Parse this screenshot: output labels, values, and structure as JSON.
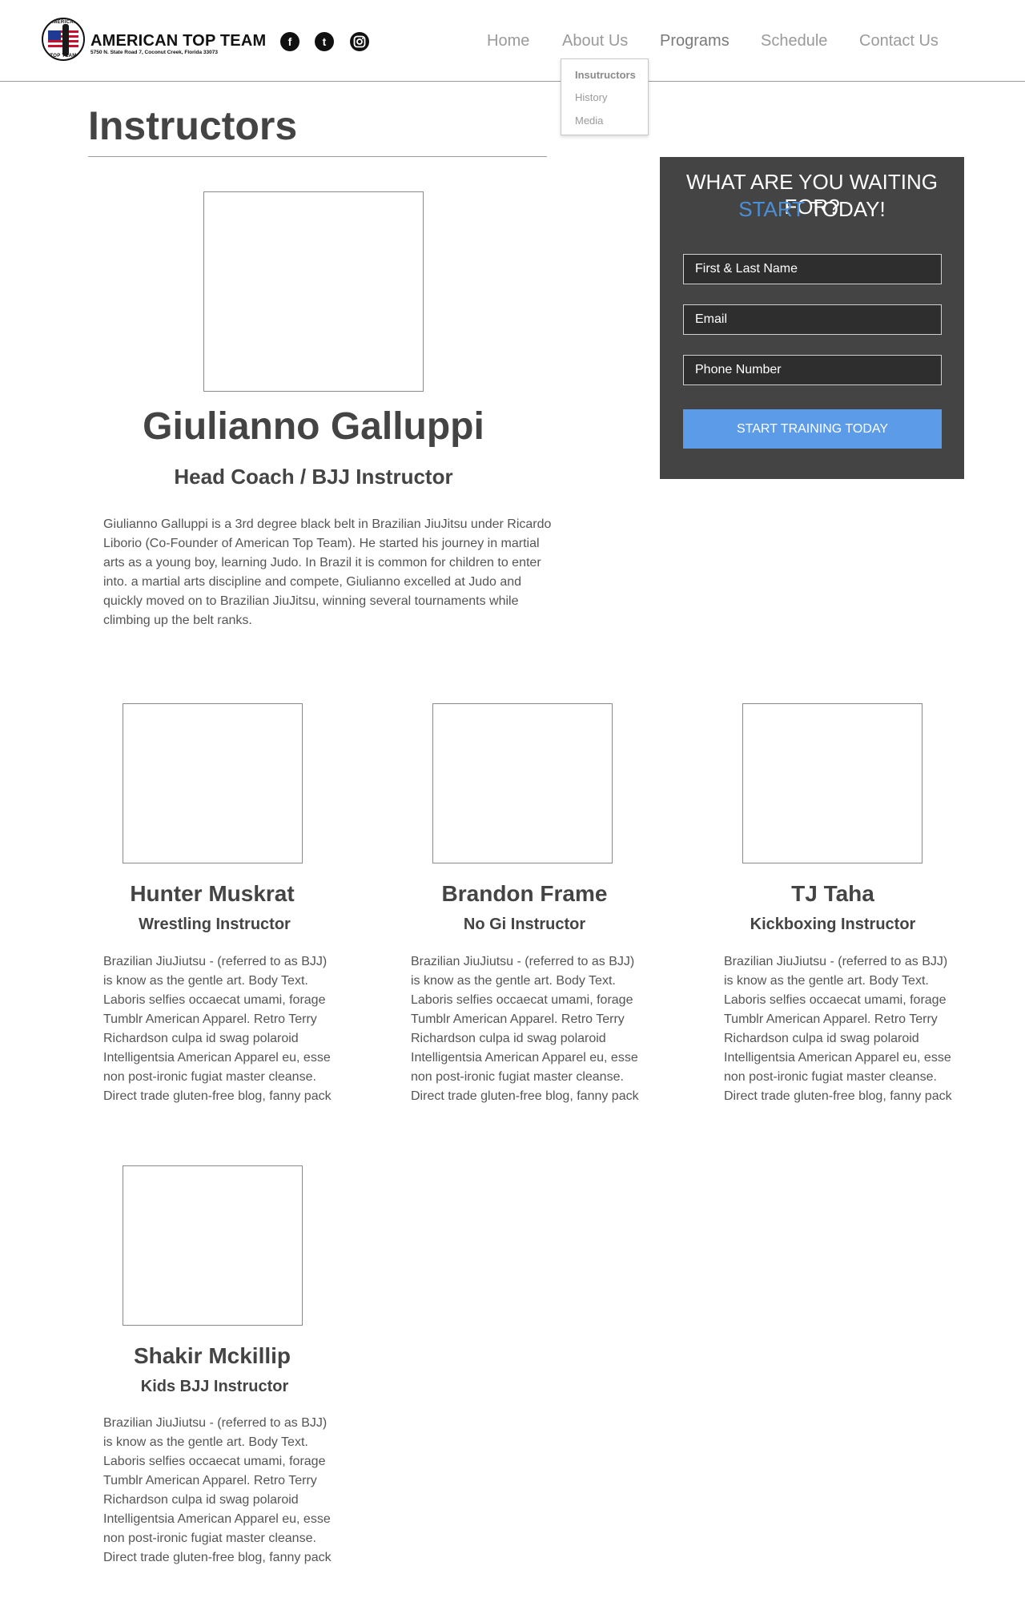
{
  "header": {
    "brand": "AMERICAN TOP TEAM",
    "address": "5750 N. State Road 7, Coconut Creek, Florida 33073",
    "logo_text_top": "AMERICAN",
    "logo_text_bottom": "TOP TEAM",
    "social": [
      {
        "icon": "facebook-icon",
        "glyph": "f"
      },
      {
        "icon": "twitter-icon",
        "glyph": "t"
      },
      {
        "icon": "instagram-icon",
        "glyph": ""
      }
    ]
  },
  "nav": {
    "items": [
      {
        "label": "Home"
      },
      {
        "label": "About Us"
      },
      {
        "label": "Programs"
      },
      {
        "label": "Schedule"
      },
      {
        "label": "Contact Us"
      }
    ],
    "dropdown": [
      {
        "label": "Insutructors"
      },
      {
        "label": "History"
      },
      {
        "label": "Media"
      }
    ]
  },
  "page": {
    "title": "Instructors"
  },
  "head_coach": {
    "name": "Giulianno Galluppi",
    "role": "Head Coach / BJJ Instructor",
    "bio": "Giulianno Galluppi is a 3rd degree black belt in Brazilian JiuJitsu under Ricardo Liborio (Co-Founder of American Top Team). He started his journey in martial arts as a young boy, learning Judo. In Brazil it is common for children to enter into. a martial arts discipline and compete, Giulianno excelled at Judo and quickly moved on to Brazilian JiuJitsu, winning several tournaments while climbing up the belt ranks."
  },
  "cta": {
    "line1": "WHAT ARE YOU WAITING FOR?",
    "line2_accent": "START",
    "line2_rest": " TODAY!",
    "name_placeholder": "First & Last Name",
    "email_placeholder": "Email",
    "phone_placeholder": "Phone Number",
    "button_label": "START TRAINING TODAY",
    "accent_color": "#4a90d9",
    "button_color": "#5b9be8"
  },
  "instructors": [
    {
      "name": "Hunter Muskrat",
      "role": "Wrestling Instructor",
      "bio": "Brazilian JiuJiutsu - (referred to as BJJ) is know as the gentle art. Body Text. Laboris selfies occaecat umami, forage Tumblr American Apparel. Retro Terry Richardson culpa id swag polaroid Intelligentsia American Apparel eu, esse non post-ironic fugiat master cleanse. Direct trade gluten-free blog, fanny pack"
    },
    {
      "name": "Brandon Frame",
      "role": "No Gi Instructor",
      "bio": "Brazilian JiuJiutsu - (referred to as BJJ) is know as the gentle art. Body Text. Laboris selfies occaecat umami, forage Tumblr American Apparel. Retro Terry Richardson culpa id swag polaroid Intelligentsia American Apparel eu, esse non post-ironic fugiat master cleanse. Direct trade gluten-free blog, fanny pack"
    },
    {
      "name": "TJ Taha",
      "role": "Kickboxing Instructor",
      "bio": "Brazilian JiuJiutsu - (referred to as BJJ) is know as the gentle art. Body Text. Laboris selfies occaecat umami, forage Tumblr American Apparel. Retro Terry Richardson culpa id swag polaroid Intelligentsia American Apparel eu, esse non post-ironic fugiat master cleanse. Direct trade gluten-free blog, fanny pack"
    },
    {
      "name": "Shakir Mckillip",
      "role": "Kids BJJ Instructor",
      "bio": "Brazilian JiuJiutsu - (referred to as BJJ) is know as the gentle art. Body Text. Laboris selfies occaecat umami, forage Tumblr American Apparel. Retro Terry Richardson culpa id swag polaroid Intelligentsia American Apparel eu, esse non post-ironic fugiat master cleanse. Direct trade gluten-free blog, fanny pack"
    }
  ]
}
